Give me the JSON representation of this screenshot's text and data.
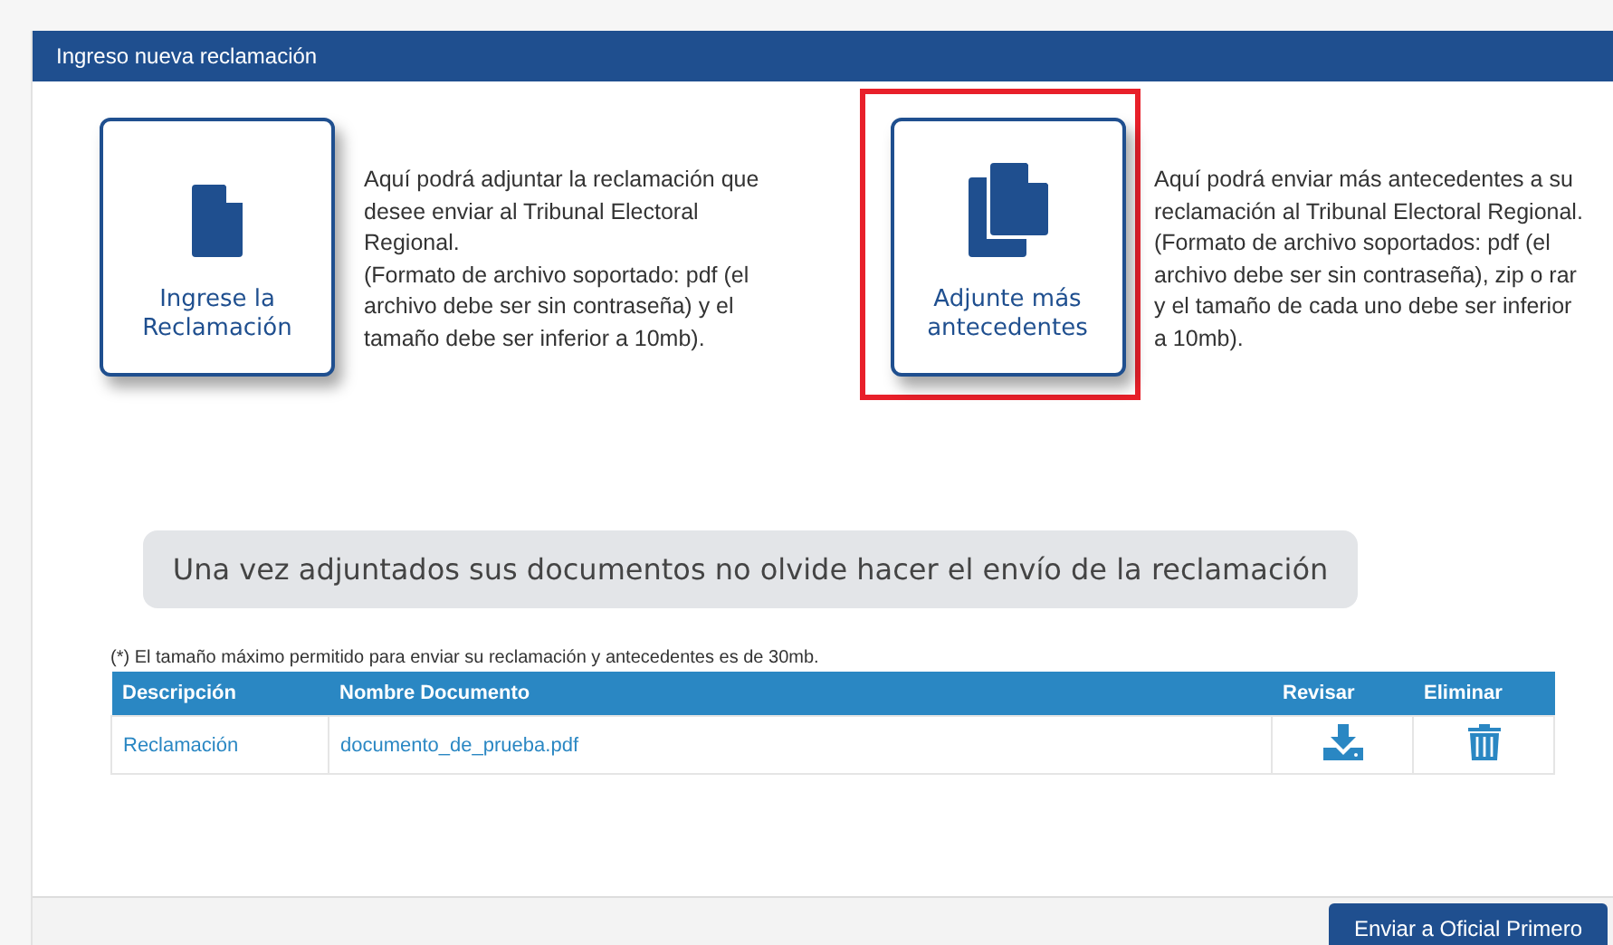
{
  "panel": {
    "title": "Ingreso nueva reclamación"
  },
  "options": [
    {
      "kind": "single",
      "label": "Ingrese la Reclamación",
      "highlighted": false,
      "description": [
        "Aquí podrá adjuntar la reclamación que desee enviar al Tribunal Electoral Regional.",
        "(Formato de archivo soportado: pdf (el archivo debe ser sin contraseña) y el tamaño debe ser inferior a 10mb)."
      ]
    },
    {
      "kind": "multiple",
      "label": "Adjunte más antecedentes",
      "highlighted": true,
      "description": [
        "Aquí podrá enviar más antecedentes a su reclamación al Tribunal Electoral Regional.",
        "(Formato de archivo soportados: pdf (el archivo debe ser sin contraseña), zip o rar y el tamaño de cada uno debe ser inferior a 10mb)."
      ]
    }
  ],
  "notice": "Una vez adjuntados sus documentos no olvide hacer el envío de la reclamación",
  "size_note": "(*) El tamaño máximo permitido para enviar su reclamación y antecedentes es de 30mb.",
  "table": {
    "columns": [
      "Descripción",
      "Nombre Documento",
      "Revisar",
      "Eliminar"
    ],
    "rows": [
      {
        "description": "Reclamación",
        "document": "documento_de_prueba.pdf"
      }
    ]
  },
  "footer": {
    "button": "Enviar a Oficial Primero"
  }
}
